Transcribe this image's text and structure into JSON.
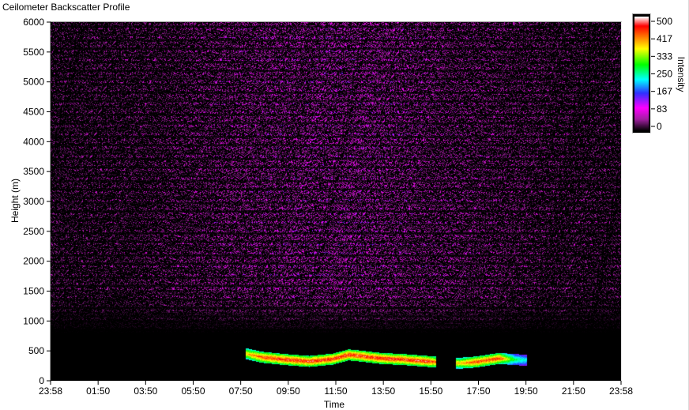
{
  "window": {
    "title": "Ceilometer Backscatter Profile"
  },
  "colors": {
    "plot_background": "#000000",
    "scale": [
      "#000000",
      "#a020a0",
      "#ff00ff",
      "#3030ff",
      "#00ffff",
      "#00ff00",
      "#ffff00",
      "#ff8000",
      "#ff0000",
      "#ffffff"
    ]
  },
  "chart_data": {
    "type": "heatmap",
    "title": "Ceilometer Backscatter Profile",
    "xlabel": "Time",
    "ylabel": "Height (m)",
    "x_tick_labels": [
      "23:58",
      "01:50",
      "03:50",
      "05:50",
      "07:50",
      "09:50",
      "11:50",
      "13:50",
      "15:50",
      "17:50",
      "19:50",
      "21:50",
      "23:58"
    ],
    "y_ticks": [
      0,
      500,
      1000,
      1500,
      2000,
      2500,
      3000,
      3500,
      4000,
      4500,
      5000,
      5500,
      6000
    ],
    "ylim": [
      0,
      6000
    ],
    "grid": false,
    "colorbar": {
      "label": "Intensity",
      "range": [
        0,
        500
      ],
      "tick_labels": [
        "500",
        "417",
        "333",
        "250",
        "167",
        "83",
        "0"
      ]
    },
    "cloud_layer": [
      {
        "time": "08:10",
        "height": 460,
        "intensity": 420
      },
      {
        "time": "08:50",
        "height": 400,
        "intensity": 480
      },
      {
        "time": "09:50",
        "height": 360,
        "intensity": 500
      },
      {
        "time": "10:50",
        "height": 330,
        "intensity": 500
      },
      {
        "time": "11:50",
        "height": 370,
        "intensity": 500
      },
      {
        "time": "12:30",
        "height": 440,
        "intensity": 500
      },
      {
        "time": "13:00",
        "height": 420,
        "intensity": 500
      },
      {
        "time": "13:50",
        "height": 380,
        "intensity": 500
      },
      {
        "time": "14:50",
        "height": 360,
        "intensity": 500
      },
      {
        "time": "15:50",
        "height": 330,
        "intensity": 500
      },
      {
        "time": "16:10",
        "height": 320,
        "intensity": 460
      },
      {
        "time": "17:10",
        "height": 300,
        "intensity": 420
      },
      {
        "time": "17:50",
        "height": 320,
        "intensity": 480
      },
      {
        "time": "18:50",
        "height": 380,
        "intensity": 480
      },
      {
        "time": "19:30",
        "height": 360,
        "intensity": 300
      },
      {
        "time": "20:00",
        "height": 350,
        "intensity": 250
      }
    ]
  }
}
